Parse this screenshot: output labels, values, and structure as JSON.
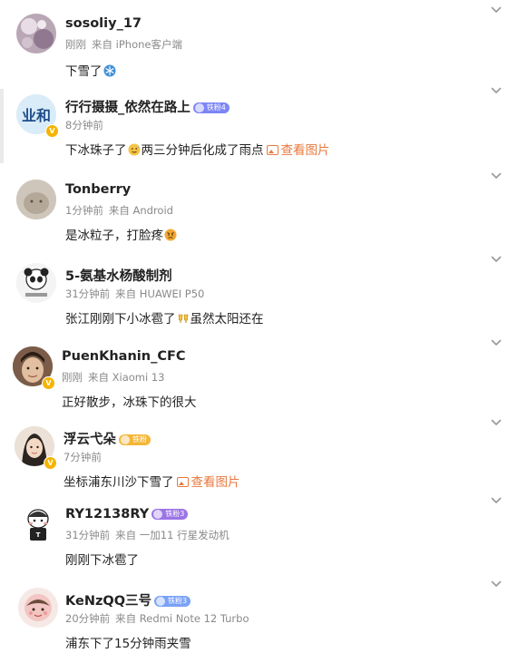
{
  "comments": [
    {
      "username": "sosoliy_17",
      "time": "刚刚",
      "source": "来自 iPhone客户端",
      "text": "下雪了",
      "emoji": "snowflake-emoji",
      "badge": null,
      "rank": null,
      "avatar_color": "#b9a7b5"
    },
    {
      "username": "行行摄摄_依然在路上",
      "time": "8分钟前",
      "source": "",
      "text": "下冰珠子了",
      "text2": "两三分钟后化成了雨点",
      "emoji": "sweat-face-emoji",
      "pic_link": "查看图片",
      "badge": "yellow",
      "rank": "铁粉4",
      "rank_color": "#7d86f5",
      "avatar_color": "#d9ecf7"
    },
    {
      "username": "Tonberry",
      "time": "1分钟前",
      "source": "来自 Android",
      "text": "是冰粒子，打脸疼",
      "emoji": "angry-face-emoji",
      "badge": null,
      "rank": null,
      "avatar_color": "#c8bfb3"
    },
    {
      "username": "5-氨基水杨酸制剂",
      "time": "31分钟前",
      "source": "来自 HUAWEI P50",
      "text": "张江刚刚下小冰雹了",
      "text2": "虽然太阳还在",
      "emoji": "cheers-emoji",
      "badge": null,
      "rank": null,
      "avatar_color": "#f0f0f0"
    },
    {
      "username": "PuenKhanin_CFC",
      "time": "刚刚",
      "source": "来自 Xiaomi 13",
      "text": "正好散步，冰珠下的很大",
      "badge": "yellow",
      "rank": null,
      "avatar_color": "#8a6a55"
    },
    {
      "username": "浮云弋朵",
      "time": "7分钟前",
      "source": "",
      "text": "坐标浦东川沙下雪了",
      "pic_link": "查看图片",
      "badge": "yellow",
      "rank": "铁粉",
      "rank_color": "#f5b638",
      "avatar_color": "#e7d6c8"
    },
    {
      "username": "RY12138RY",
      "time": "31分钟前",
      "source": "来自 一加11 行星发动机",
      "text": "刚刚下冰雹了",
      "badge": null,
      "rank": "铁粉3",
      "rank_color": "#9b74e6",
      "avatar_color": "#ffffff"
    },
    {
      "username": "KeNzQQ三号",
      "time": "20分钟前",
      "source": "来自 Redmi Note 12 Turbo",
      "text": "浦东下了15分钟雨夹雪",
      "badge": null,
      "rank": "铁粉3",
      "rank_color": "#7aa2f7",
      "avatar_color": "#f3e4e0"
    }
  ],
  "colors": {
    "username": "#222222",
    "meta": "#8a8a8a",
    "link": "#e8793d",
    "chevron": "#999999"
  }
}
